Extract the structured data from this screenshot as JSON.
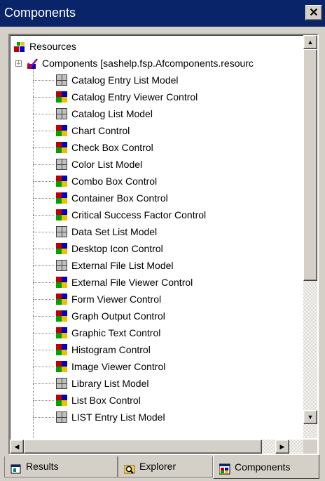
{
  "window": {
    "title": "Components",
    "close_label": "✕"
  },
  "tree": {
    "root": {
      "label": "Resources",
      "icon": "resources-icon"
    },
    "catalog": {
      "label": "Components [sashelp.fsp.Afcomponents.resourc",
      "icon": "catalog-check-icon",
      "expander": "−"
    },
    "items": [
      {
        "label": "Catalog Entry List Model",
        "type": "model"
      },
      {
        "label": "Catalog Entry Viewer Control",
        "type": "control"
      },
      {
        "label": "Catalog List Model",
        "type": "model"
      },
      {
        "label": "Chart Control",
        "type": "control"
      },
      {
        "label": "Check Box Control",
        "type": "control"
      },
      {
        "label": "Color List Model",
        "type": "model"
      },
      {
        "label": "Combo Box Control",
        "type": "control"
      },
      {
        "label": "Container Box Control",
        "type": "control"
      },
      {
        "label": "Critical Success Factor Control",
        "type": "control"
      },
      {
        "label": "Data Set List Model",
        "type": "model"
      },
      {
        "label": "Desktop Icon Control",
        "type": "control"
      },
      {
        "label": "External File List Model",
        "type": "model"
      },
      {
        "label": "External File Viewer Control",
        "type": "control"
      },
      {
        "label": "Form Viewer Control",
        "type": "control"
      },
      {
        "label": "Graph Output Control",
        "type": "control"
      },
      {
        "label": "Graphic Text Control",
        "type": "control"
      },
      {
        "label": "Histogram Control",
        "type": "control"
      },
      {
        "label": "Image Viewer Control",
        "type": "control"
      },
      {
        "label": "Library List Model",
        "type": "model"
      },
      {
        "label": "List Box Control",
        "type": "control"
      },
      {
        "label": "LIST Entry List Model",
        "type": "model"
      }
    ]
  },
  "scrollbars": {
    "up": "▲",
    "down": "▼",
    "left": "◀",
    "right": "▶",
    "vertical_position": 0.0,
    "horizontal_position": 0.0
  },
  "tabs": [
    {
      "label": "Results",
      "icon": "results-icon",
      "active": false
    },
    {
      "label": "Explorer",
      "icon": "explorer-icon",
      "active": false
    },
    {
      "label": "Components",
      "icon": "components-icon",
      "active": true
    }
  ]
}
